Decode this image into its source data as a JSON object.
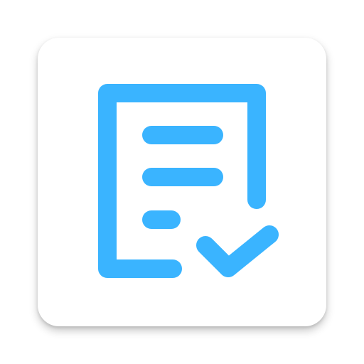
{
  "app_icon": {
    "name": "document-checked-icon",
    "tile_color": "#FFFFFF",
    "glyph_color": "#3AB4FF"
  }
}
